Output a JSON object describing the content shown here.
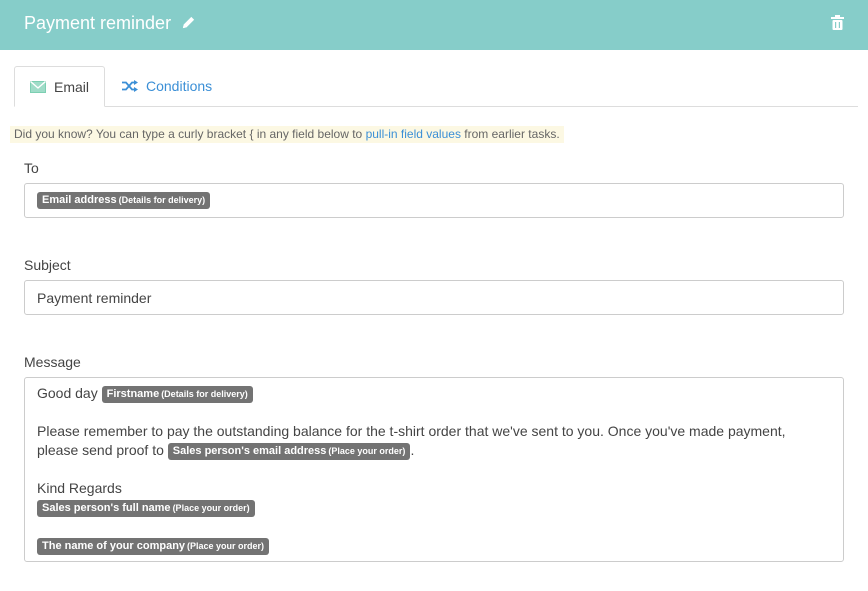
{
  "header": {
    "title": "Payment reminder",
    "bg_color": "#86cdc9"
  },
  "tabs": [
    {
      "label": "Email",
      "active": true,
      "icon": "envelope-icon"
    },
    {
      "label": "Conditions",
      "active": false,
      "icon": "shuffle-icon"
    }
  ],
  "tip": {
    "text_before": "Did you know? You can type a curly bracket { in any field below to",
    "link": "pull-in field values",
    "text_after": "from earlier tasks."
  },
  "to": {
    "label": "To",
    "chip_main": "Email address",
    "chip_sub": "(Details for delivery)"
  },
  "subject": {
    "label": "Subject",
    "value": "Payment reminder"
  },
  "message": {
    "label": "Message",
    "greeting": "Good day",
    "greeting_chip_main": "Firstname",
    "greeting_chip_sub": "(Details for delivery)",
    "line1": "Please remember to pay the outstanding balance for the t-shirt order that we've sent to you. Once you've made payment,",
    "line2_prefix": "please send proof to",
    "line2_chip_main": "Sales person's email address",
    "line2_chip_sub": "(Place your order)",
    "line2_suffix": ".",
    "regards": "Kind Regards",
    "sig_chip1_main": "Sales person's full name",
    "sig_chip1_sub": "(Place your order)",
    "sig_chip2_main": "The name of your company",
    "sig_chip2_sub": "(Place your order)"
  }
}
